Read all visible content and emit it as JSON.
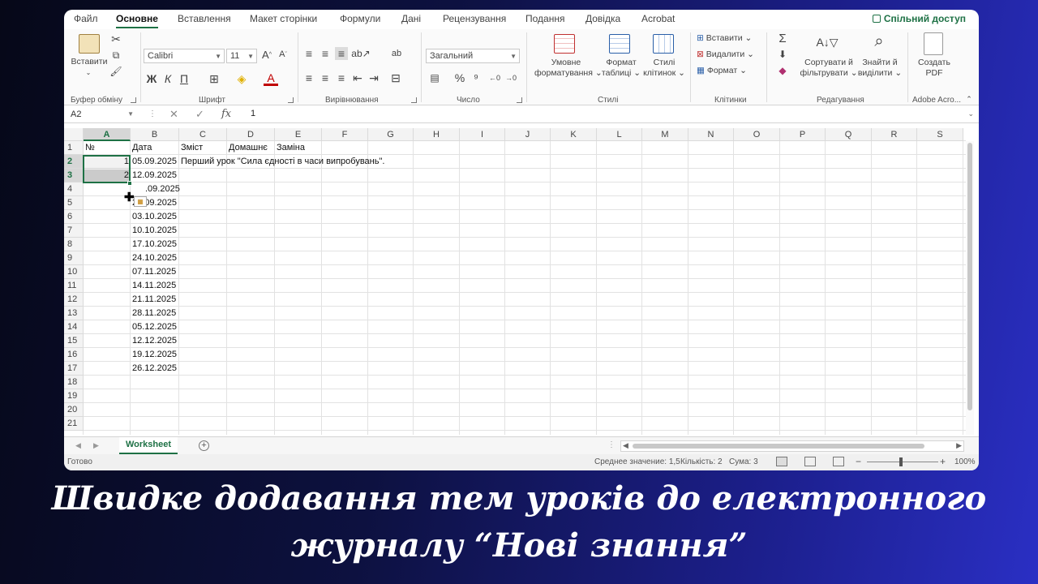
{
  "ribbon_tabs": [
    "Файл",
    "Основне",
    "Вставлення",
    "Макет сторінки",
    "Формули",
    "Дані",
    "Рецензування",
    "Подання",
    "Довідка",
    "Acrobat"
  ],
  "active_tab": "Основне",
  "share_label": "Спільний доступ",
  "clipboard": {
    "paste": "Вставити",
    "group": "Буфер обміну"
  },
  "font": {
    "name": "Calibri",
    "size": "11",
    "bold": "Ж",
    "italic": "К",
    "underline": "П",
    "group": "Шрифт",
    "grow": "A",
    "color_a": "A"
  },
  "alignment": {
    "group": "Вирівнювання"
  },
  "number": {
    "format": "Загальний",
    "percent": "%",
    "group": "Число"
  },
  "styles": {
    "conditional": "Умовне",
    "conditional2": "форматування",
    "format_table": "Формат",
    "format_table2": "таблиці",
    "cell_styles": "Стилі",
    "cell_styles2": "клітинок",
    "group": "Стилі"
  },
  "cells": {
    "insert": "Вставити",
    "delete": "Видалити",
    "format": "Формат",
    "group": "Клітинки"
  },
  "editing": {
    "sum": "Σ",
    "sort": "Сортувати й",
    "sort2": "фільтрувати",
    "find": "Знайти й",
    "find2": "виділити",
    "group": "Редагування"
  },
  "adobe": {
    "create": "Создать",
    "pdf": "PDF",
    "group": "Adobe Acro..."
  },
  "formula_bar": {
    "name_box": "A2",
    "cancel": "✕",
    "enter": "✓",
    "fx": "fx",
    "value": "1"
  },
  "columns": [
    "A",
    "B",
    "C",
    "D",
    "E",
    "F",
    "G",
    "H",
    "I",
    "J",
    "K",
    "L",
    "M",
    "N",
    "O",
    "P",
    "Q",
    "R",
    "S"
  ],
  "rows": [
    "1",
    "2",
    "3",
    "4",
    "5",
    "6",
    "7",
    "8",
    "9",
    "10",
    "11",
    "12",
    "13",
    "14",
    "15",
    "16",
    "17",
    "18",
    "19",
    "20",
    "21"
  ],
  "header_row": {
    "a": "№",
    "b": "Дата",
    "c": "Зміст",
    "d": "Домашнє",
    "e": "Заміна"
  },
  "cell_values": {
    "a2": "1",
    "a3": "2",
    "c2": "Перший урок \"Сила єдності в часи випробувань\"."
  },
  "dates": [
    "05.09.2025",
    "12.09.2025",
    ".09.2025",
    "26.09.2025",
    "03.10.2025",
    "10.10.2025",
    "17.10.2025",
    "24.10.2025",
    "07.11.2025",
    "14.11.2025",
    "21.11.2025",
    "28.11.2025",
    "05.12.2025",
    "12.12.2025",
    "19.12.2025",
    "26.12.2025"
  ],
  "sheet_tab": "Worksheet",
  "status": {
    "ready": "Готово",
    "average": "Среднее значение: 1,5",
    "count": "Кількість: 2",
    "sum": "Сума: 3",
    "zoom": "100%"
  },
  "caption": {
    "line1": "Швидке додавання тем уроків до електронного",
    "line2": "журналу “Нові знання”"
  },
  "colors": {
    "accent": "#1e7145"
  }
}
